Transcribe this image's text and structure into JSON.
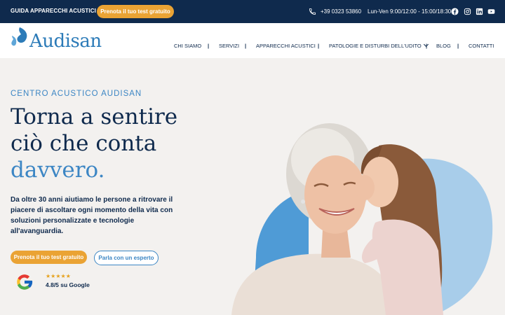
{
  "topbar": {
    "guide_label": "GUIDA APPARECCHI ACUSTICI",
    "cta_label": "Prenota il tuo test gratuito",
    "phone": "+39 0323 53860",
    "hours": "Lun-Ven 9:00/12:00 - 15:00/18:30"
  },
  "header": {
    "logo_text": "Audisan",
    "nav": {
      "chi_siamo": "CHI SIAMO",
      "servizi": "SERVIZI",
      "apparecchi": "APPARECCHI ACUSTICI",
      "patologie": "PATOLOGIE E DISTURBI DELL'UDITO",
      "blog": "BLOG",
      "contatti": "CONTATTI"
    },
    "separator": "|"
  },
  "hero": {
    "eyebrow": "CENTRO ACUSTICO AUDISAN",
    "title_line1": "Torna a sentire",
    "title_line2": "ciò che conta",
    "title_accent": "davvero.",
    "description": "Da oltre 30 anni aiutiamo le persone a ritrovare il piacere di ascoltare ogni momento della vita con soluzioni personalizzate e tecnologie all'avanguardia.",
    "primary_cta": "Prenota il tuo test gratuito",
    "secondary_cta": "Parla con un esperto",
    "stars": "★★★★★",
    "rating_text": "4.8/5 su Google",
    "rating": 4.8
  },
  "colors": {
    "navy": "#0f2a4d",
    "brand_blue": "#3c86c4",
    "orange": "#eaa334",
    "hero_bg": "#f3f1ef"
  },
  "icons": [
    "phone-icon",
    "facebook-icon",
    "instagram-icon",
    "linkedin-icon",
    "youtube-icon",
    "google-icon"
  ]
}
